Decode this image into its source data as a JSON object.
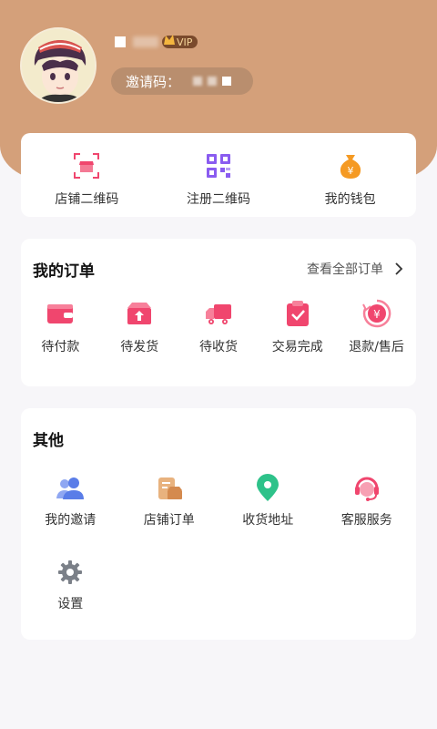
{
  "profile": {
    "vip_label": "VIP",
    "invite_label": "邀请码："
  },
  "quick_actions": [
    {
      "label": "店铺二维码",
      "icon": "store-qrcode-icon"
    },
    {
      "label": "注册二维码",
      "icon": "register-qrcode-icon"
    },
    {
      "label": "我的钱包",
      "icon": "wallet-icon"
    }
  ],
  "orders": {
    "title": "我的订单",
    "view_all": "查看全部订单",
    "items": [
      {
        "label": "待付款",
        "icon": "pending-payment-icon"
      },
      {
        "label": "待发货",
        "icon": "pending-shipment-icon"
      },
      {
        "label": "待收货",
        "icon": "pending-receipt-icon"
      },
      {
        "label": "交易完成",
        "icon": "completed-icon"
      },
      {
        "label": "退款/售后",
        "icon": "refund-icon"
      }
    ]
  },
  "other": {
    "title": "其他",
    "items": [
      {
        "label": "我的邀请",
        "icon": "invite-users-icon"
      },
      {
        "label": "店铺订单",
        "icon": "store-orders-icon"
      },
      {
        "label": "收货地址",
        "icon": "location-pin-icon"
      },
      {
        "label": "客服服务",
        "icon": "customer-service-icon"
      },
      {
        "label": "设置",
        "icon": "gear-icon"
      }
    ]
  },
  "colors": {
    "header": "#d4a07a",
    "accent_pink": "#f0466e",
    "purple": "#8a5cf0",
    "orange": "#f59a23",
    "blue": "#5a7de8",
    "green": "#2ec28a",
    "gray": "#7b8088"
  }
}
